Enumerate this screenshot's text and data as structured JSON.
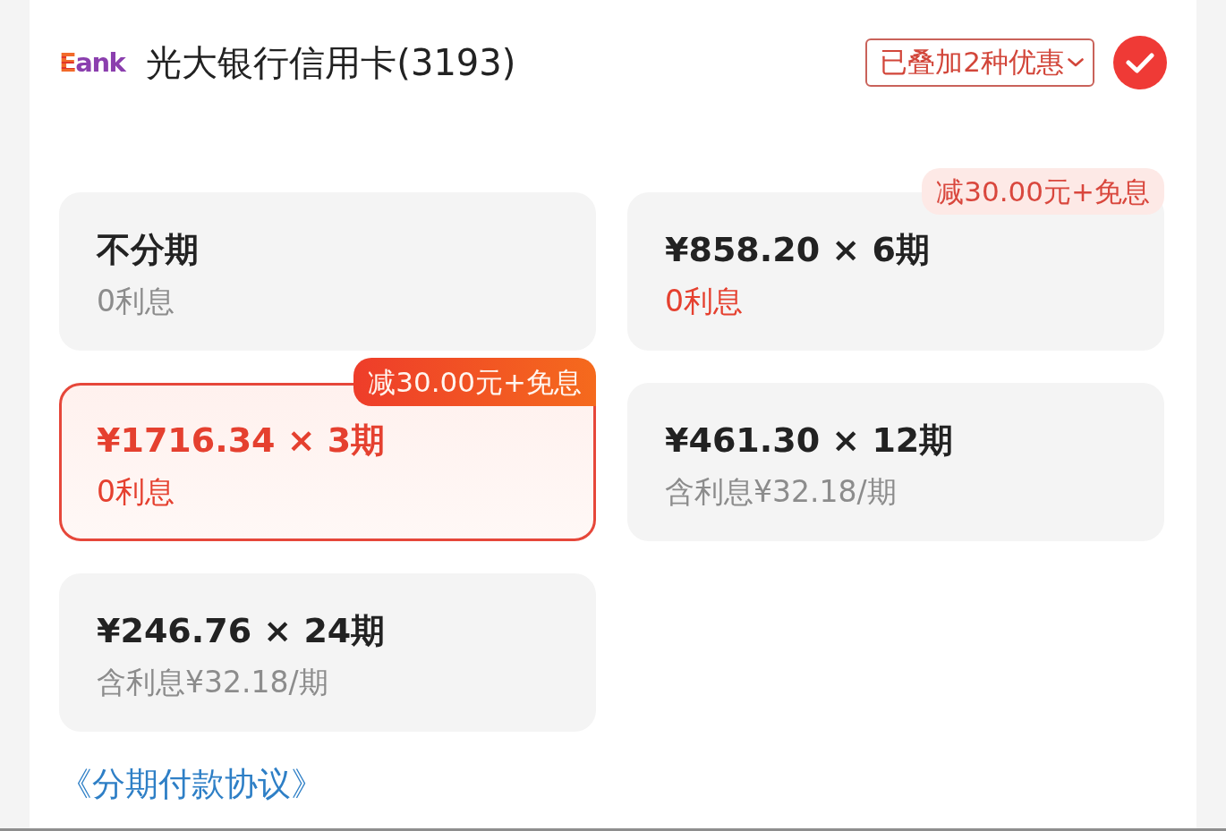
{
  "account": {
    "logo_mark": "E",
    "logo_text": "ank",
    "title": "光大银行信用卡(3193)",
    "checked": true
  },
  "discount_button": {
    "label": "已叠加2种优惠"
  },
  "plans": [
    {
      "title": "不分期",
      "subtitle": "0利息",
      "selected": false,
      "highlight": false
    },
    {
      "title": "¥858.20 × 6期",
      "subtitle": "0利息",
      "tag": "减30.00元+免息",
      "selected": false,
      "highlight": true
    },
    {
      "title": "¥1716.34 × 3期",
      "subtitle": "0利息",
      "tag": "减30.00元+免息",
      "selected": true,
      "highlight": true
    },
    {
      "title": "¥461.30 × 12期",
      "subtitle": "含利息¥32.18/期",
      "selected": false,
      "highlight": false
    },
    {
      "title": "¥246.76 × 24期",
      "subtitle": "含利息¥32.18/期",
      "selected": false,
      "highlight": false
    }
  ],
  "agreement_link": "《分期付款协议》"
}
